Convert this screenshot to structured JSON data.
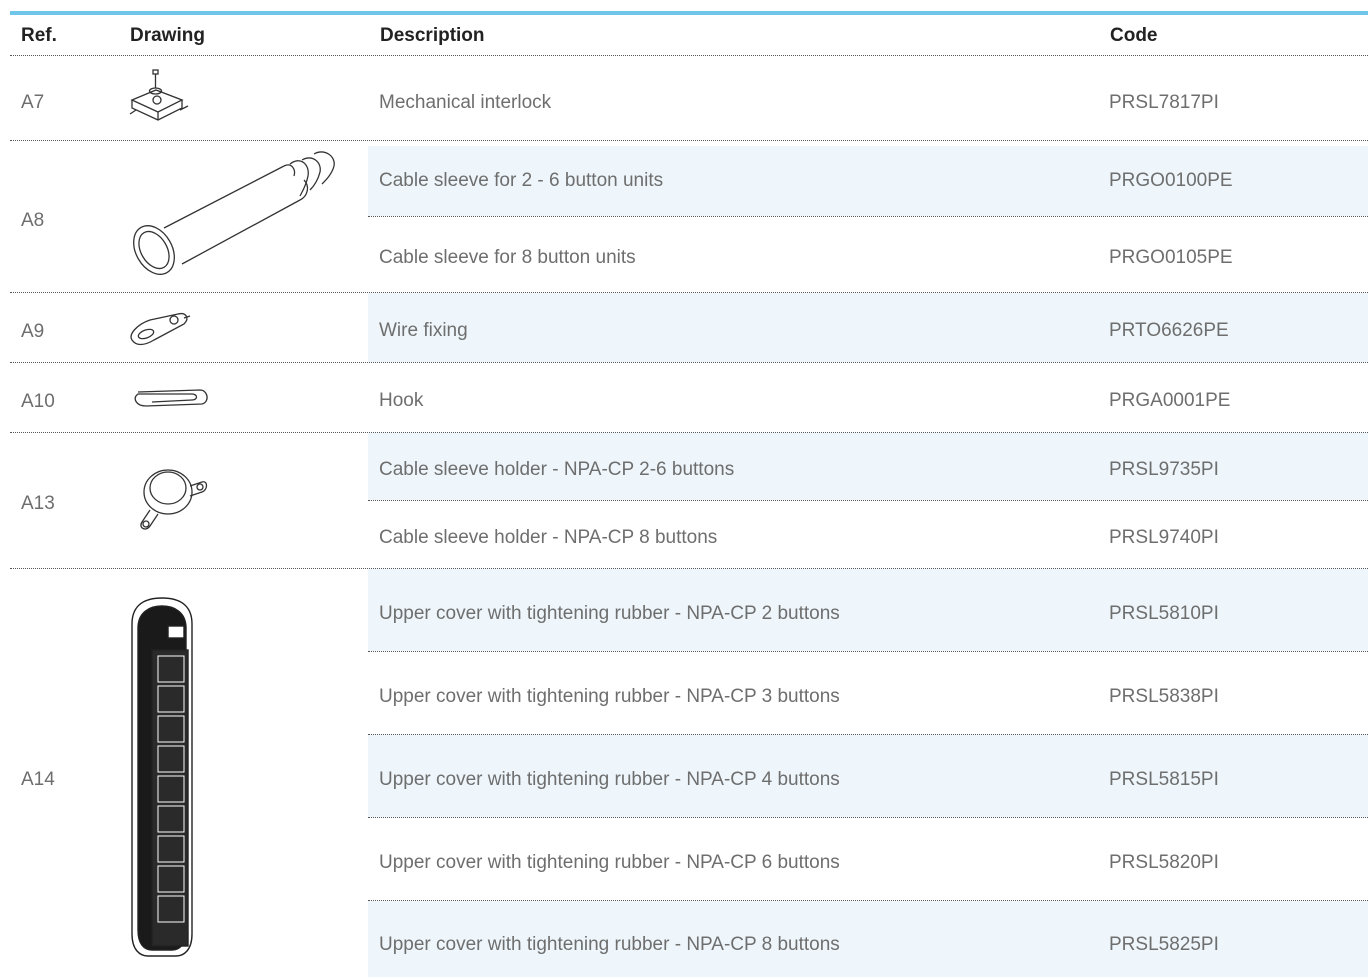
{
  "header": {
    "ref": "Ref.",
    "drawing": "Drawing",
    "description": "Description",
    "code": "Code"
  },
  "groups": [
    {
      "ref": "A7",
      "drawing": "mechanical-interlock-drawing",
      "items": [
        {
          "description": "Mechanical interlock",
          "code": "PRSL7817PI"
        }
      ]
    },
    {
      "ref": "A8",
      "drawing": "cable-sleeve-drawing",
      "items": [
        {
          "description": "Cable sleeve for 2 - 6 button units",
          "code": "PRGO0100PE"
        },
        {
          "description": "Cable sleeve for 8 button units",
          "code": "PRGO0105PE"
        }
      ]
    },
    {
      "ref": "A9",
      "drawing": "wire-fixing-drawing",
      "items": [
        {
          "description": "Wire fixing",
          "code": "PRTO6626PE"
        }
      ]
    },
    {
      "ref": "A10",
      "drawing": "hook-drawing",
      "items": [
        {
          "description": "Hook",
          "code": "PRGA0001PE"
        }
      ]
    },
    {
      "ref": "A13",
      "drawing": "cable-sleeve-holder-drawing",
      "items": [
        {
          "description": "Cable sleeve holder - NPA-CP 2-6 buttons",
          "code": "PRSL9735PI"
        },
        {
          "description": "Cable sleeve holder - NPA-CP 8 buttons",
          "code": "PRSL9740PI"
        }
      ]
    },
    {
      "ref": "A14",
      "drawing": "upper-cover-drawing",
      "items": [
        {
          "description": "Upper cover with tightening rubber - NPA-CP 2 buttons",
          "code": "PRSL5810PI"
        },
        {
          "description": "Upper cover with tightening rubber - NPA-CP 3 buttons",
          "code": "PRSL5838PI"
        },
        {
          "description": "Upper cover with tightening rubber - NPA-CP 4 buttons",
          "code": "PRSL5815PI"
        },
        {
          "description": "Upper cover with tightening rubber - NPA-CP 6 buttons",
          "code": "PRSL5820PI"
        },
        {
          "description": "Upper cover with tightening rubber - NPA-CP 8 buttons",
          "code": "PRSL5825PI"
        }
      ]
    }
  ],
  "colors": {
    "accent": "#6fc6ea",
    "row_shade": "#eef6fb",
    "text": "#6e6e6e",
    "header_text": "#222222"
  }
}
